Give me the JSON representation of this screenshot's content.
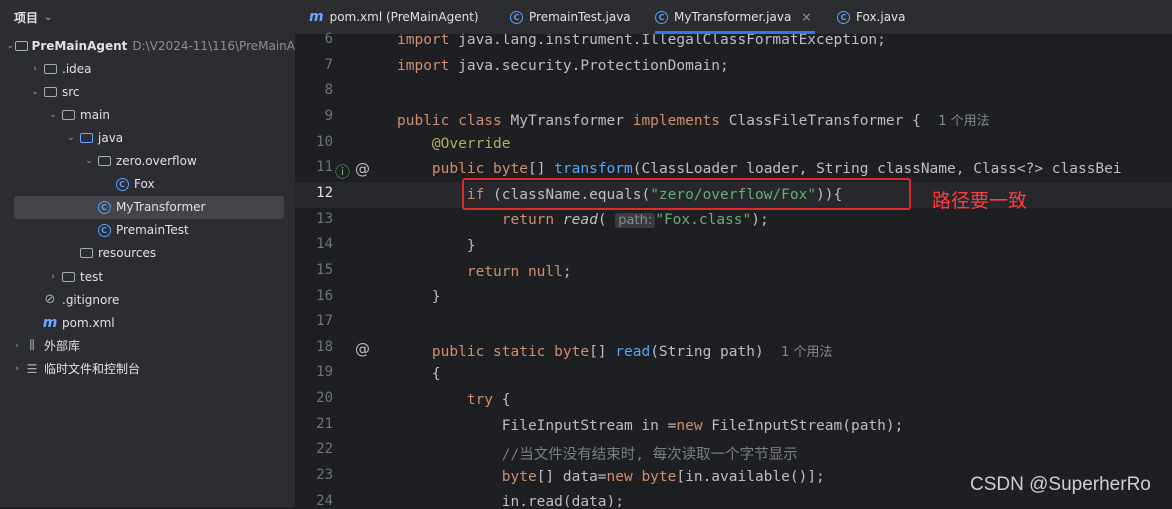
{
  "project": {
    "header": "项目",
    "tree": [
      {
        "label": "PreMainAgent",
        "path": "D:\\V2024-11\\116\\PreMainA",
        "icon": "module-folder-icon",
        "arrow": "v",
        "indent": 0
      },
      {
        "label": ".idea",
        "icon": "folder-icon",
        "arrow": ">",
        "indent": 1
      },
      {
        "label": "src",
        "icon": "folder-icon",
        "arrow": "v",
        "indent": 1
      },
      {
        "label": "main",
        "icon": "folder-icon",
        "arrow": "v",
        "indent": 2
      },
      {
        "label": "java",
        "icon": "source-folder-icon",
        "arrow": "v",
        "indent": 3
      },
      {
        "label": "zero.overflow",
        "icon": "package-icon",
        "arrow": "v",
        "indent": 4
      },
      {
        "label": "Fox",
        "icon": "class-icon",
        "arrow": "",
        "indent": 5
      },
      {
        "label": "MyTransformer",
        "icon": "class-icon",
        "arrow": "",
        "indent": 4,
        "selected": true
      },
      {
        "label": "PremainTest",
        "icon": "class-icon",
        "arrow": "",
        "indent": 4
      },
      {
        "label": "resources",
        "icon": "resources-folder-icon",
        "arrow": "",
        "indent": 3
      },
      {
        "label": "test",
        "icon": "folder-icon",
        "arrow": ">",
        "indent": 2
      },
      {
        "label": ".gitignore",
        "icon": "gitignore-icon",
        "arrow": "",
        "indent": 1
      },
      {
        "label": "pom.xml",
        "icon": "maven-icon",
        "arrow": "",
        "indent": 1
      },
      {
        "label": "外部库",
        "icon": "library-icon",
        "arrow": ">",
        "indent": 0
      },
      {
        "label": "临时文件和控制台",
        "icon": "scratches-icon",
        "arrow": ">",
        "indent": 0
      }
    ]
  },
  "tabs": [
    {
      "label": "pom.xml (PreMainAgent)",
      "icon": "maven-icon"
    },
    {
      "label": "PremainTest.java",
      "icon": "class-icon"
    },
    {
      "label": "MyTransformer.java",
      "icon": "class-icon",
      "active": true,
      "close": "×"
    },
    {
      "label": "Fox.java",
      "icon": "class-icon"
    }
  ],
  "editor": {
    "line_numbers": [
      "6",
      "7",
      "8",
      "9",
      "10",
      "11",
      "12",
      "13",
      "14",
      "15",
      "16",
      "17",
      "18",
      "19",
      "20",
      "21",
      "22",
      "23",
      "24"
    ],
    "current_line": "12",
    "usage_hint_1": "1 个用法",
    "usage_hint_2": "1 个用法",
    "param_hint": "path:",
    "annotation_text": "路径要一致",
    "watermark": "CSDN @SuperherRo"
  }
}
